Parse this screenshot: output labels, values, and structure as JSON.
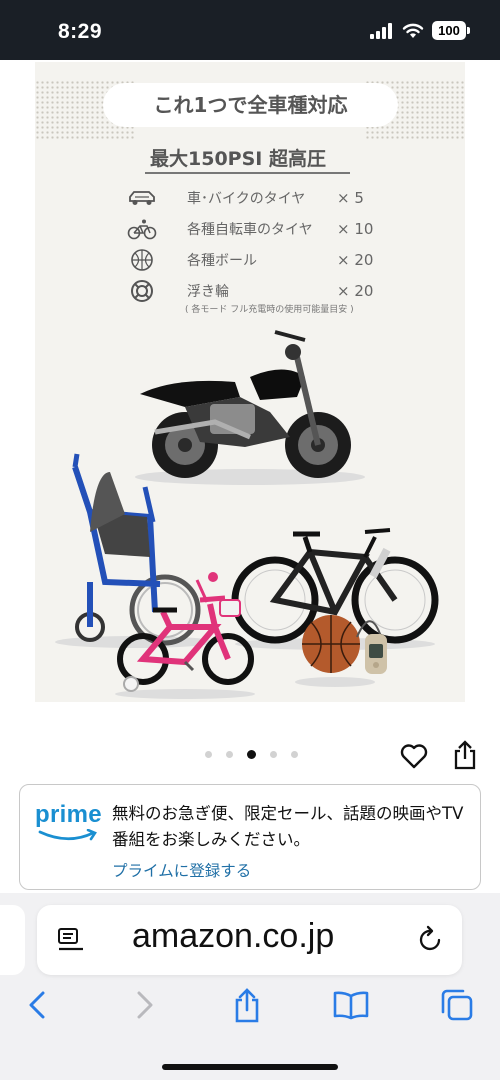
{
  "status_bar": {
    "time": "8:29",
    "battery": "100",
    "icons": [
      "signal-icon",
      "wifi-icon",
      "battery-icon"
    ]
  },
  "product_image": {
    "headline": "これ1つで全車種対応",
    "subheadline": "最大150PSI 超高圧",
    "specs": [
      {
        "icon": "car-icon",
        "label": "車･バイクのタイヤ",
        "count": "× 5"
      },
      {
        "icon": "bicycle-icon",
        "label": "各種自転車のタイヤ",
        "count": "× 10"
      },
      {
        "icon": "ball-icon",
        "label": "各種ボール",
        "count": "× 20"
      },
      {
        "icon": "float-ring-icon",
        "label": "浮き輪",
        "count": "× 20"
      }
    ],
    "note": "( 各モード フル充電時の使用可能量目安 )",
    "vehicle_icons": [
      "motorcycle-icon",
      "wheelchair-icon",
      "mountain-bike-icon",
      "kids-bike-icon",
      "basketball-icon",
      "air-pump-icon"
    ]
  },
  "carousel": {
    "dot_count": 5,
    "active_index": 2
  },
  "prime_banner": {
    "logo": "prime",
    "text": "無料のお急ぎ便、限定セール、話題の映画やTV番組をお楽しみください。",
    "link": "プライムに登録する"
  },
  "browser": {
    "url": "amazon.co.jp",
    "toolbar_icons": [
      "back-icon",
      "forward-icon",
      "share-icon",
      "bookmarks-icon",
      "tabs-icon"
    ]
  },
  "colors": {
    "status_bar_bg": "#1a1f26",
    "prime_blue": "#1a8fd1",
    "link_blue": "#1f6fa6",
    "browser_bg": "#f1f1f3",
    "ios_blue": "#2a7ce6",
    "kids_bike_pink": "#e0337a",
    "wheelchair_blue": "#2350b8"
  }
}
